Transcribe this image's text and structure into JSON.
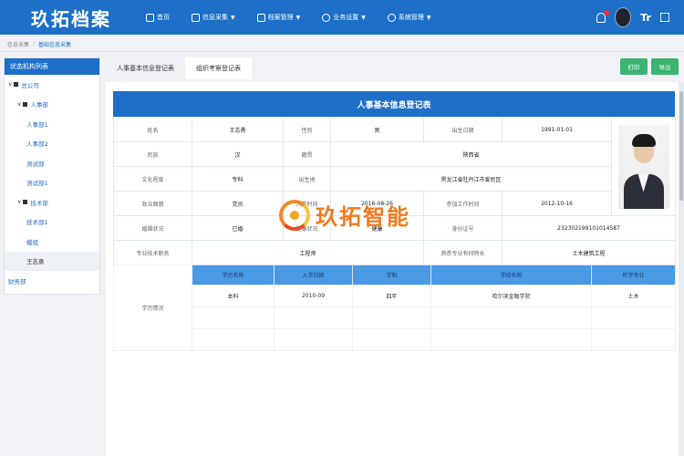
{
  "app": {
    "title": "玖拓档案"
  },
  "nav": [
    {
      "label": "首页",
      "icon": "home-icon",
      "has_menu": false
    },
    {
      "label": "信息采集",
      "icon": "collect-icon",
      "has_menu": true
    },
    {
      "label": "档案管理",
      "icon": "archive-icon",
      "has_menu": true
    },
    {
      "label": "业务设置",
      "icon": "settings-icon",
      "has_menu": true
    },
    {
      "label": "系统管理",
      "icon": "system-icon",
      "has_menu": true
    }
  ],
  "header": {
    "font_toggle": "Tr"
  },
  "breadcrumb": {
    "items": [
      "信息采集",
      "基础信息采集"
    ]
  },
  "sidebar": {
    "title": "状态机构列表",
    "tree": [
      {
        "label": "总公司",
        "level": "root",
        "toggle": "∨"
      },
      {
        "label": "人事部",
        "level": "lvl1",
        "toggle": "∨"
      },
      {
        "label": "人事部1",
        "level": "lvl2"
      },
      {
        "label": "人事部2",
        "level": "lvl2"
      },
      {
        "label": "测试部",
        "level": "lvl2"
      },
      {
        "label": "测试部1",
        "level": "lvl2"
      },
      {
        "label": "技术部",
        "level": "lvl1",
        "toggle": "∨"
      },
      {
        "label": "技术部1",
        "level": "lvl2"
      },
      {
        "label": "模组",
        "level": "lvl2"
      },
      {
        "label": "王志勇",
        "level": "lvl2",
        "selected": true
      },
      {
        "label": "财务部",
        "level": "root"
      }
    ]
  },
  "tabs": [
    {
      "label": "人事基本信息登记表",
      "active": true
    },
    {
      "label": "组织考察登记表",
      "active": false
    }
  ],
  "buttons": {
    "print": "打印",
    "export": "导出"
  },
  "form": {
    "title": "人事基本信息登记表",
    "rows": [
      [
        "姓名",
        "王志勇",
        "性别",
        "男",
        "出生日期",
        "1991-01-01"
      ],
      [
        "民族",
        "汉",
        "籍贯",
        "陕西省"
      ],
      [
        "文化程度",
        "专科",
        "出生地",
        "黑龙江省牡丹江市爱民区"
      ],
      [
        "政治面貌",
        "党员",
        "入党时间",
        "2016-08-26",
        "参加工作时间",
        "2012-10-16"
      ],
      [
        "婚姻状况",
        "已婚",
        "健康状况",
        "健康",
        "身份证号",
        "232302199101014587"
      ],
      [
        "专业技术职务",
        "工程师",
        "熟悉专业有何特长",
        "土木建筑工程"
      ]
    ],
    "education": {
      "side_label": "学历情况",
      "columns": [
        "学历名称",
        "入学日期",
        "学制",
        "学校名称",
        "所学专业"
      ],
      "rows": [
        [
          "本科",
          "2010-09",
          "四年",
          "哈尔滨金融学院",
          "土木"
        ]
      ]
    }
  },
  "watermark": {
    "text": "玖拓智能"
  }
}
